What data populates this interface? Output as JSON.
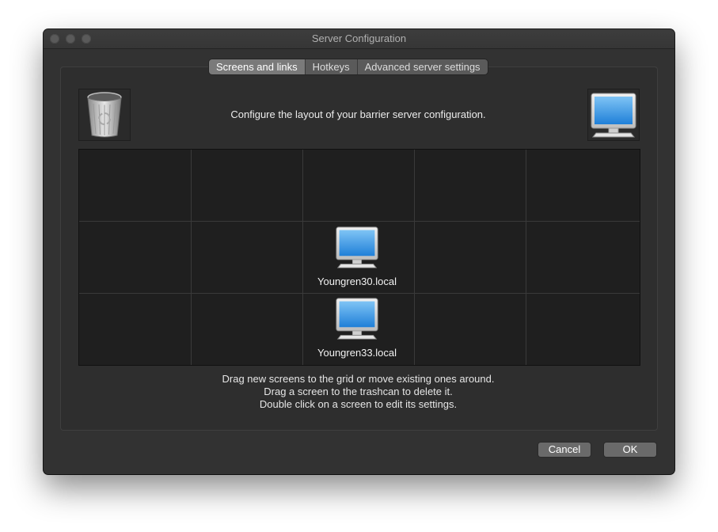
{
  "window": {
    "title": "Server Configuration"
  },
  "tabs": [
    {
      "label": "Screens and links",
      "active": true
    },
    {
      "label": "Hotkeys",
      "active": false
    },
    {
      "label": "Advanced server settings",
      "active": false
    }
  ],
  "screens_tab": {
    "heading": "Configure the layout of your barrier server configuration.",
    "trash_icon": "trashcan-icon",
    "new_screen_icon": "monitor-icon",
    "grid": {
      "columns": 5,
      "rows": 3
    },
    "screens": [
      {
        "name": "Youngren30.local",
        "column": 3,
        "row": 2
      },
      {
        "name": "Youngren33.local",
        "column": 3,
        "row": 3
      }
    ],
    "help_lines": [
      "Drag new screens to the grid or move existing ones around.",
      "Drag a screen to the trashcan to delete it.",
      "Double click on a screen to edit its settings."
    ]
  },
  "buttons": {
    "cancel": "Cancel",
    "ok": "OK"
  },
  "colors": {
    "window_bg": "#323232",
    "grid_bg": "#1f1f1f",
    "button_bg": "#6a6a6a",
    "active_tab_bg": "#7a7a7a"
  }
}
